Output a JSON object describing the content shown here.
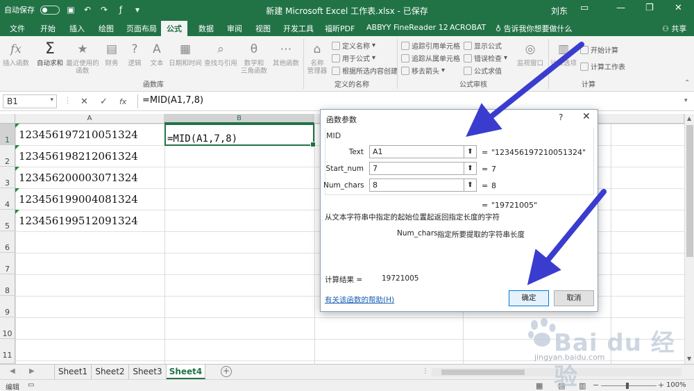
{
  "titlebar": {
    "autosave_label": "自动保存",
    "title": "新建 Microsoft Excel 工作表.xlsx - 已保存",
    "user": "刘东"
  },
  "ribbon_tabs": [
    {
      "label": "文件",
      "active": false
    },
    {
      "label": "开始",
      "active": false
    },
    {
      "label": "插入",
      "active": false
    },
    {
      "label": "绘图",
      "active": false
    },
    {
      "label": "页面布局",
      "active": false
    },
    {
      "label": "公式",
      "active": true
    },
    {
      "label": "数据",
      "active": false
    },
    {
      "label": "审阅",
      "active": false
    },
    {
      "label": "视图",
      "active": false
    },
    {
      "label": "开发工具",
      "active": false
    },
    {
      "label": "福昕PDF",
      "active": false
    },
    {
      "label": "ABBYY FineReader 12",
      "active": false
    },
    {
      "label": "ACROBAT",
      "active": false
    }
  ],
  "tell_me": "告诉我你想要做什么",
  "share": "共享",
  "ribbon": {
    "function_library": {
      "label": "函数库",
      "insert_function": "插入函数",
      "autosum": "自动求和",
      "recent_1": "最近使用的",
      "recent_2": "函数",
      "financial": "财务",
      "logical": "逻辑",
      "text": "文本",
      "datetime": "日期和时间",
      "lookup": "查找与引用",
      "math_1": "数学和",
      "math_2": "三角函数",
      "more": "其他函数"
    },
    "defined_names": {
      "label": "定义的名称",
      "name_manager_1": "名称",
      "name_manager_2": "管理器",
      "define_name": "定义名称",
      "use_in_formula": "用于公式",
      "create_from_selection": "根据所选内容创建"
    },
    "formula_auditing": {
      "label": "公式审核",
      "trace_precedents": "追踪引用单元格",
      "trace_dependents": "追踪从属单元格",
      "remove_arrows": "移去箭头",
      "show_formulas": "显示公式",
      "error_checking": "错误检查",
      "evaluate_formula": "公式求值",
      "watch_window": "监视窗口"
    },
    "calculation": {
      "label": "计算",
      "options": "计算选项",
      "calc_now": "开始计算",
      "calc_sheet": "计算工作表"
    }
  },
  "formula_bar": {
    "name_box": "B1",
    "fx": "fx",
    "formula": "=MID(A1,7,8)"
  },
  "columns": [
    "A",
    "B"
  ],
  "rows": [
    "1",
    "2",
    "3",
    "4",
    "5",
    "6",
    "7",
    "8",
    "9",
    "10",
    "11"
  ],
  "cells_a": [
    "123456197210051324",
    "123456198212061324",
    "123456200003071324",
    "123456199004081324",
    "123456199512091324"
  ],
  "cell_b1": "=MID(A1,7,8)",
  "sheets": [
    {
      "name": "Sheet1",
      "active": false
    },
    {
      "name": "Sheet2",
      "active": false
    },
    {
      "name": "Sheet3",
      "active": false
    },
    {
      "name": "Sheet4",
      "active": true
    }
  ],
  "status": {
    "mode": "编辑",
    "zoom": "100%"
  },
  "dialog": {
    "title": "函数参数",
    "help": "?",
    "function_name": "MID",
    "args": [
      {
        "label": "Text",
        "value": "A1",
        "result": "\"123456197210051324\""
      },
      {
        "label": "Start_num",
        "value": "7",
        "result": "7"
      },
      {
        "label": "Num_chars",
        "value": "8",
        "result": "8"
      }
    ],
    "equals": "=",
    "overall_result": "\"19721005\"",
    "description": "从文本字符串中指定的起始位置起返回指定长度的字符",
    "param_name": "Num_chars",
    "param_desc": "指定所要提取的字符串长度",
    "calc_result_label": "计算结果 =",
    "calc_result_value": "19721005",
    "help_link": "有关该函数的帮助(H)",
    "ok": "确定",
    "cancel": "取消"
  },
  "watermark": {
    "brand": "Bai du 经验",
    "url": "jingyan.baidu.com"
  },
  "colors": {
    "excel_green": "#217346",
    "arrow": "#3a3ccf"
  }
}
